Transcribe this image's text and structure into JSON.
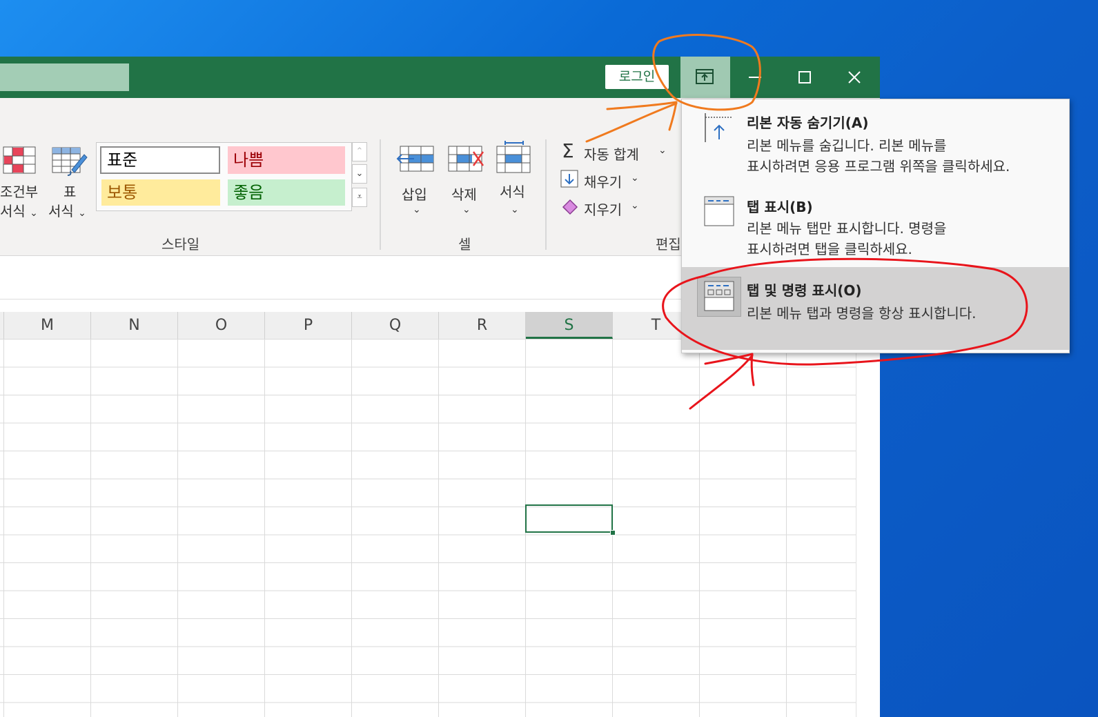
{
  "titlebar": {
    "login_label": "로그인",
    "minimize_glyph": "—",
    "maximize_glyph": "☐",
    "close_glyph": "✕"
  },
  "ribbon": {
    "conditional_format": {
      "line1": "조건부",
      "line2": "서식"
    },
    "table_format": {
      "line1": "표",
      "line2": "서식"
    },
    "styles": {
      "normal": "표준",
      "bad": "나쁨",
      "neutral": "보통",
      "good": "좋음",
      "group_label": "스타일"
    },
    "cells": {
      "insert": "삽입",
      "delete": "삭제",
      "format": "서식",
      "group_label": "셀"
    },
    "editing": {
      "autosum": "자동 합계",
      "fill": "채우기",
      "clear": "지우기",
      "group_label": "편집"
    }
  },
  "grid": {
    "columns": [
      "M",
      "N",
      "O",
      "P",
      "Q",
      "R",
      "S",
      "T"
    ],
    "selected_column": "S"
  },
  "menu": {
    "items": [
      {
        "title": "리본 자동 숨기기(A)",
        "desc1": "리본 메뉴를 숨깁니다. 리본 메뉴를",
        "desc2": "표시하려면 응용 프로그램 위쪽을 클릭하세요.",
        "icon": "auto-hide-icon"
      },
      {
        "title": "탭 표시(B)",
        "desc1": "리본 메뉴 탭만 표시합니다. 명령을",
        "desc2": "표시하려면 탭을 클릭하세요.",
        "icon": "show-tabs-icon"
      },
      {
        "title": "탭 및 명령 표시(O)",
        "desc1": "리본 메뉴 탭과 명령을 항상 표시합니다.",
        "icon": "show-tabs-commands-icon"
      }
    ]
  },
  "colors": {
    "excel_green": "#217346",
    "annotation_orange": "#f07a1e",
    "annotation_red": "#e8141b"
  }
}
